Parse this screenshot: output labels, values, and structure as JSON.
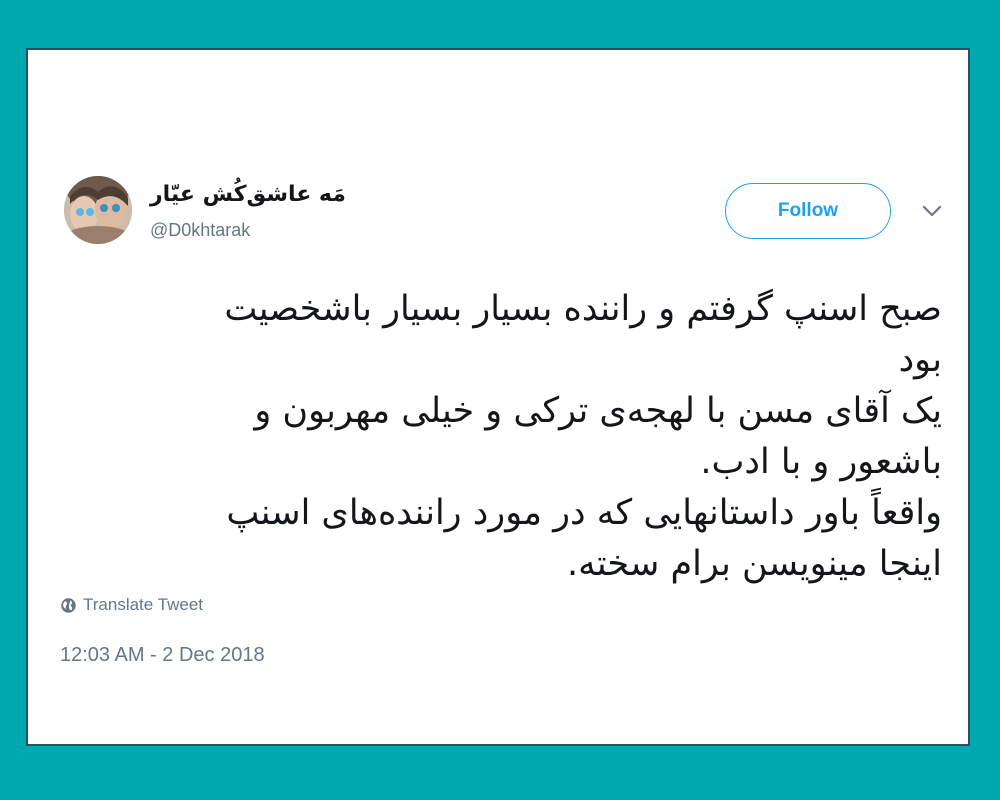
{
  "tweet": {
    "author": {
      "display_name": "مَه عاشق‌کُش عیّار",
      "handle": "@D0khtarak"
    },
    "follow_label": "Follow",
    "text_lines": [
      "صبح اسنپ گرفتم و راننده بسیار بسیار باشخصیت",
      "بود",
      "یک آقای مسن با لهجه‌ی ترکی و خیلی مهربون و",
      "باشعور و با ادب.",
      "واقعاً باور داستانهایی که در مورد راننده‌های اسنپ",
      "اینجا مینویسن برام سخته."
    ],
    "translate_label": "Translate Tweet",
    "timestamp": "12:03 AM - 2 Dec 2018"
  },
  "icons": {
    "globe": "globe-icon",
    "caret": "chevron-down-icon",
    "avatar": "avatar"
  },
  "colors": {
    "page_background": "#00a8b0",
    "card_border": "#2c4f66",
    "accent": "#1da1f2",
    "secondary_text": "#657786",
    "primary_text": "#14171a"
  }
}
